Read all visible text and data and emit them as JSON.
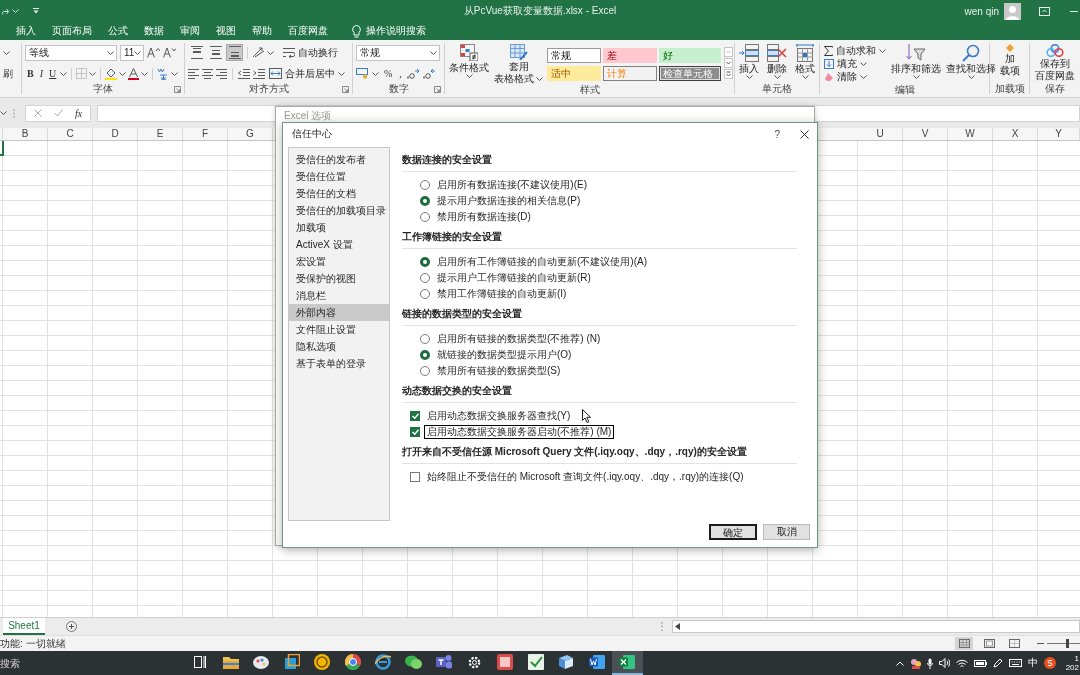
{
  "title_bar": {
    "title": "从PcVue获取变量数据.xlsx - Excel",
    "user": "wen qin"
  },
  "ribbon_tabs": [
    {
      "label": "插入",
      "selected": false
    },
    {
      "label": "页面布局",
      "selected": false
    },
    {
      "label": "公式",
      "selected": false
    },
    {
      "label": "数据",
      "selected": false
    },
    {
      "label": "审阅",
      "selected": false
    },
    {
      "label": "视图",
      "selected": false
    },
    {
      "label": "帮助",
      "selected": false
    },
    {
      "label": "百度网盘",
      "selected": false
    }
  ],
  "tell_me": "操作说明搜索",
  "ribbon": {
    "clipboard": {
      "format_painter": "刷"
    },
    "font": {
      "label": "字体",
      "font_name": "等线",
      "font_size": "11",
      "bold": "B",
      "italic": "I",
      "underline": "U"
    },
    "alignment": {
      "label": "对齐方式",
      "vertical_align": [
        {
          "kind": "top",
          "selected": false
        },
        {
          "kind": "middle",
          "selected": false
        },
        {
          "kind": "bottom",
          "selected": true
        }
      ],
      "wrap_text": "自动换行",
      "merge_center": "合并后居中"
    },
    "number": {
      "label": "数字",
      "format": "常规",
      "percent": "%",
      "comma": ","
    },
    "styles": {
      "label": "样式",
      "conditional_formatting": "条件格式",
      "format_as_table": [
        "套用",
        "表格格式"
      ],
      "cell_styles": [
        {
          "label": "常规",
          "kind": "normal"
        },
        {
          "label": "差",
          "kind": "bad"
        },
        {
          "label": "好",
          "kind": "good"
        },
        {
          "label": "适中",
          "kind": "neutral"
        },
        {
          "label": "计算",
          "kind": "calculation"
        },
        {
          "label": "检查单元格",
          "kind": "check"
        }
      ]
    },
    "cells": {
      "label": "单元格",
      "buttons": [
        {
          "kind": "insert",
          "label": "插入"
        },
        {
          "kind": "delete",
          "label": "删除"
        },
        {
          "kind": "format",
          "label": "格式"
        }
      ]
    },
    "editing": {
      "label": "编辑",
      "autosum": "自动求和",
      "fill": "填充",
      "clear": "清除",
      "sort_filter": "排序和筛选",
      "find_select": "查找和选择"
    },
    "add_ins": {
      "label": "加载项",
      "button": [
        "加",
        "载项"
      ]
    },
    "save": {
      "label": "保存",
      "button": [
        "保存到",
        "百度网盘"
      ]
    }
  },
  "formula_bar": {
    "function": "fx"
  },
  "columns_left": [
    "B",
    "C",
    "D",
    "E",
    "F",
    "G"
  ],
  "columns_right": [
    "U",
    "V",
    "W",
    "X",
    "Y"
  ],
  "sheet_tabs": [
    {
      "label": "Sheet1",
      "selected": true
    }
  ],
  "status_bar": {
    "text": "功能: 一切就绪",
    "views": [
      {
        "kind": "normal",
        "selected": true
      },
      {
        "kind": "page_layout",
        "selected": false
      },
      {
        "kind": "page_break",
        "selected": false
      }
    ],
    "zoom_slider": {
      "level": 0.6
    }
  },
  "taskbar": {
    "search": {
      "placeholder": "搜索"
    },
    "apps": [
      {
        "kind": "task_view",
        "active": false
      },
      {
        "kind": "folder",
        "active": false
      },
      {
        "kind": "palette",
        "active": false
      },
      {
        "kind": "window",
        "active": false
      },
      {
        "kind": "coin",
        "active": false
      },
      {
        "kind": "ring",
        "active": false
      },
      {
        "kind": "globe_e",
        "active": false
      },
      {
        "kind": "chat",
        "active": false
      },
      {
        "kind": "team",
        "active": false
      },
      {
        "kind": "gear",
        "active": false
      },
      {
        "kind": "red_tile",
        "active": false
      },
      {
        "kind": "check_tile",
        "active": false
      },
      {
        "kind": "book",
        "active": false
      },
      {
        "kind": "doc",
        "active": false
      },
      {
        "kind": "sheet",
        "active": true
      }
    ],
    "ime": "中",
    "clock": [
      "1",
      "202"
    ]
  },
  "options_dialog": {
    "title": "Excel 选项"
  },
  "trust_center": {
    "title": "信任中心",
    "help": "?",
    "nav": [
      {
        "label": "受信任的发布者",
        "selected": false
      },
      {
        "label": "受信任位置",
        "selected": false
      },
      {
        "label": "受信任的文档",
        "selected": false
      },
      {
        "label": "受信任的加载项目录",
        "selected": false
      },
      {
        "label": "加载项",
        "selected": false
      },
      {
        "label": "ActiveX 设置",
        "selected": false
      },
      {
        "label": "宏设置",
        "selected": false
      },
      {
        "label": "受保护的视图",
        "selected": false
      },
      {
        "label": "消息栏",
        "selected": false
      },
      {
        "label": "外部内容",
        "selected": true
      },
      {
        "label": "文件阻止设置",
        "selected": false
      },
      {
        "label": "隐私选项",
        "selected": false
      },
      {
        "label": "基于表单的登录",
        "selected": false
      }
    ],
    "sections": [
      {
        "heading": "数据连接的安全设置",
        "options": [
          {
            "kind": "radio",
            "label": "启用所有数据连接(不建议使用)(E)",
            "selected": false,
            "focused": false
          },
          {
            "kind": "radio",
            "label": "提示用户数据连接的相关信息(P)",
            "selected": true,
            "focused": false
          },
          {
            "kind": "radio",
            "label": "禁用所有数据连接(D)",
            "selected": false,
            "focused": false
          }
        ]
      },
      {
        "heading": "工作簿链接的安全设置",
        "options": [
          {
            "kind": "radio",
            "label": "启用所有工作簿链接的自动更新(不建议使用)(A)",
            "selected": true,
            "focused": false
          },
          {
            "kind": "radio",
            "label": "提示用户工作簿链接的自动更新(R)",
            "selected": false,
            "focused": false
          },
          {
            "kind": "radio",
            "label": "禁用工作簿链接的自动更新(I)",
            "selected": false,
            "focused": false
          }
        ]
      },
      {
        "heading": "链接的数据类型的安全设置",
        "options": [
          {
            "kind": "radio",
            "label": "启用所有链接的数据类型(不推荐) (N)",
            "selected": false,
            "focused": false
          },
          {
            "kind": "radio",
            "label": "就链接的数据类型提示用户(O)",
            "selected": true,
            "focused": false
          },
          {
            "kind": "radio",
            "label": "禁用所有链接的数据类型(S)",
            "selected": false,
            "focused": false
          }
        ]
      },
      {
        "heading": "动态数据交换的安全设置",
        "options": [
          {
            "kind": "checkbox",
            "label": "启用动态数据交换服务器查找(Y)",
            "checked": true,
            "focused": false
          },
          {
            "kind": "checkbox",
            "label": "启用动态数据交换服务器启动(不推荐) (M)",
            "checked": true,
            "focused": true
          }
        ]
      },
      {
        "heading": "打开来自不受信任源 Microsoft Query 文件(.iqy.oqy、.dqy，.rqy)的安全设置",
        "options": [
          {
            "kind": "checkbox",
            "label": "始终阻止不受信任的 Microsoft 查询文件(.iqy.oqy、.dqy，.rqy)的连接(Q)",
            "checked": false,
            "focused": false
          }
        ]
      }
    ],
    "buttons": [
      {
        "label": "确定",
        "default": true
      },
      {
        "label": "取消",
        "default": false
      }
    ]
  }
}
